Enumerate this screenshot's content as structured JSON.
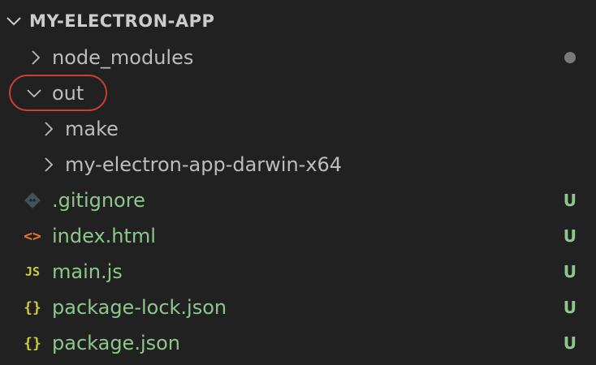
{
  "explorer": {
    "section_title": "MY-ELECTRON-APP",
    "folders": [
      {
        "label": "node_modules",
        "expanded": false,
        "badge": "modified-dot"
      },
      {
        "label": "out",
        "expanded": true,
        "highlighted": true
      },
      {
        "label": "make",
        "expanded": false
      },
      {
        "label": "my-electron-app-darwin-x64",
        "expanded": false
      }
    ],
    "files": [
      {
        "label": ".gitignore",
        "icon": "git-icon",
        "status": "U"
      },
      {
        "label": "index.html",
        "icon": "html-icon",
        "icon_text": "<>",
        "status": "U"
      },
      {
        "label": "main.js",
        "icon": "js-icon",
        "icon_text": "JS",
        "status": "U"
      },
      {
        "label": "package-lock.json",
        "icon": "json-icon",
        "icon_text": "{}",
        "status": "U"
      },
      {
        "label": "package.json",
        "icon": "json-icon",
        "icon_text": "{}",
        "status": "U"
      }
    ]
  },
  "colors": {
    "background": "#212121",
    "folder_text": "#bdbdbd",
    "untracked_text": "#8dc78c",
    "highlight_ring": "#c9402d",
    "html_icon": "#e37933",
    "js_icon": "#cbcb41",
    "json_icon": "#cbcb41",
    "git_icon": "#41535b"
  }
}
